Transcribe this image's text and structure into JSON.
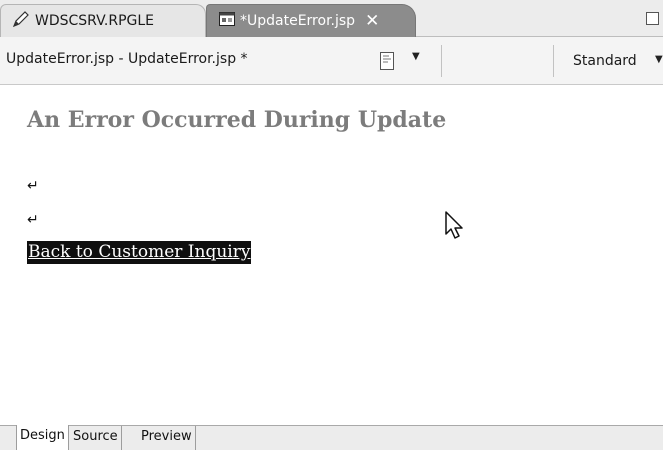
{
  "tabs": [
    {
      "label": "WDSCSRV.RPGLE",
      "icon": "pencil-icon",
      "active": false
    },
    {
      "label": "*UpdateError.jsp",
      "icon": "jsp-file-icon",
      "active": true,
      "close_label": "✕"
    }
  ],
  "toolbar": {
    "title": "UpdateError.jsp - UpdateError.jsp *",
    "page_button_icon": "page-icon",
    "layout_mode": "Standard"
  },
  "document": {
    "heading": "An Error Occurred During Update",
    "paragraph_mark": "↵",
    "link_text": "Back to Customer Inquiry"
  },
  "bottom_tabs": [
    "Design",
    "Source",
    "Preview"
  ],
  "colors": {
    "active_tab": "#8c8c8c",
    "heading_text": "#7c7c7c",
    "selection": "#0f0f0f"
  }
}
